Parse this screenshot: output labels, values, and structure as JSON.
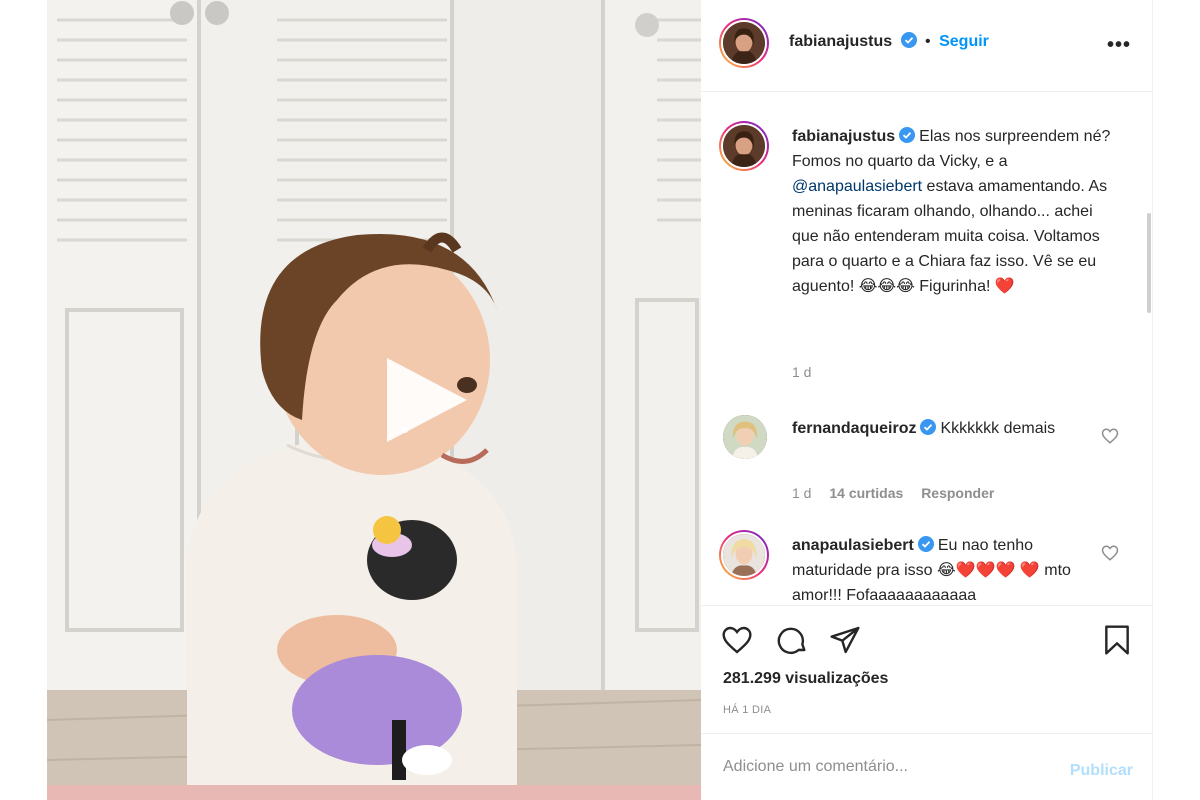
{
  "post": {
    "author": "fabianajustus",
    "follow_label": "Seguir",
    "dot": "•",
    "more": "•••"
  },
  "caption": {
    "author": "fabianajustus",
    "text_a": "Elas nos surpreendem né? Fomos no quarto da Vicky, e a ",
    "mention": "@anapaulasiebert",
    "text_b": " estava amamentando. As meninas ficaram olhando, olhando... achei que não entenderam muita coisa. Voltamos para o quarto e a Chiara faz isso. Vê se eu aguento! ",
    "emojis": "😂😂😂",
    "text_c": " Figurinha! ",
    "heart": "❤️",
    "time": "1 d"
  },
  "comments": [
    {
      "author": "fernandaqueiroz",
      "text": "Kkkkkkk demais",
      "time": "1 d",
      "likes": "14 curtidas",
      "reply": "Responder"
    },
    {
      "author": "anapaulasiebert",
      "text_a": "Eu nao tenho maturidade pra isso ",
      "emojis": "😂❤️❤️❤️",
      "text_b": "❤️ mto amor!!! Fofaaaaaaaaaaaa"
    }
  ],
  "stats": {
    "views": "281.299 visualizações",
    "ago": "HÁ 1 DIA"
  },
  "composer": {
    "placeholder": "Adicione um comentário...",
    "publish": "Publicar"
  },
  "colors": {
    "accent": "#0095f6",
    "mention": "#00376b",
    "muted": "#8e8e8e",
    "publish_disabled": "#b2dffc"
  }
}
